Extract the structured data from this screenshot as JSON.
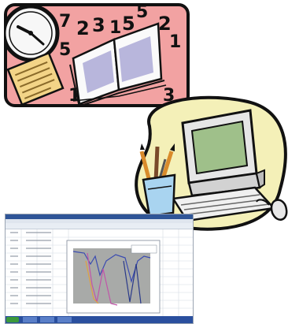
{
  "palette": {
    "study_background": "#f2a2a2",
    "study_border": "#111111",
    "computer_blob": "#f4f0b8",
    "computer_screen": "#9fc08a",
    "spreadsheet_chart_bg": "#a8aaa8",
    "taskbar": "#2a4f9e"
  },
  "digits": [
    "7",
    "2",
    "3",
    "1",
    "5",
    "5",
    "2",
    "1",
    "5",
    "1",
    "3"
  ],
  "icons": {
    "clock": "clock-icon",
    "book": "open-book-icon",
    "notepad": "notepad-icon",
    "computer": "desktop-computer-icon",
    "mouse": "mouse-icon",
    "pencil_cup": "pencil-cup-icon"
  }
}
